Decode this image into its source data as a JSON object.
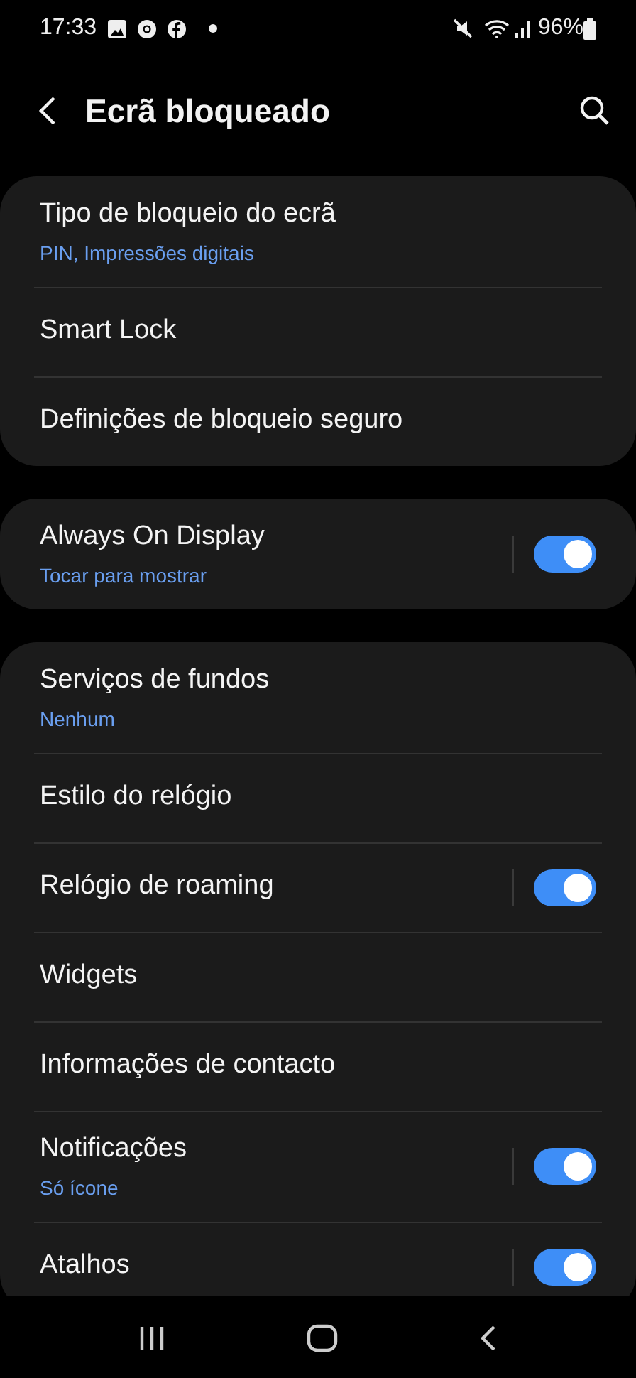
{
  "status_bar": {
    "time": "17:33",
    "battery": "96%"
  },
  "header": {
    "title": "Ecrã bloqueado"
  },
  "groups": [
    {
      "items": [
        {
          "kind": "link",
          "title": "Tipo de bloqueio do ecrã",
          "subtitle": "PIN, Impressões digitais"
        },
        {
          "kind": "link",
          "title": "Smart Lock"
        },
        {
          "kind": "link",
          "title": "Definições de bloqueio seguro"
        }
      ]
    },
    {
      "items": [
        {
          "kind": "toggle",
          "title": "Always On Display",
          "subtitle": "Tocar para mostrar",
          "on": true
        }
      ]
    },
    {
      "items": [
        {
          "kind": "link",
          "title": "Serviços de fundos",
          "subtitle": "Nenhum"
        },
        {
          "kind": "link",
          "title": "Estilo do relógio"
        },
        {
          "kind": "toggle",
          "title": "Relógio de roaming",
          "on": true
        },
        {
          "kind": "link",
          "title": "Widgets"
        },
        {
          "kind": "link",
          "title": "Informações de contacto"
        },
        {
          "kind": "toggle",
          "title": "Notificações",
          "subtitle": "Só ícone",
          "on": true
        },
        {
          "kind": "toggle",
          "title": "Atalhos",
          "on": true
        }
      ]
    }
  ]
}
